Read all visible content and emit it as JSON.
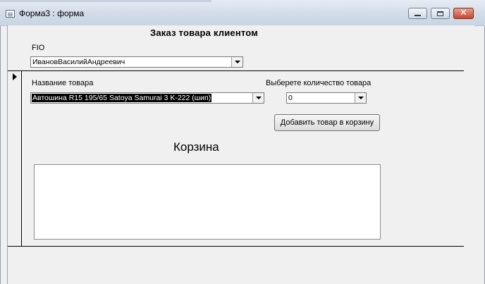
{
  "window": {
    "title": "Форма3 : форма",
    "minimize_icon": "minimize-icon",
    "maximize_icon": "maximize-icon",
    "close_icon": "close-icon",
    "close_glyph": "✕"
  },
  "form": {
    "title": "Заказ товара клиентом",
    "fio": {
      "label": "FIO",
      "value": "ИвановВасилийАндреевич"
    },
    "product": {
      "label": "Название товара",
      "value": "Автошина R15 195/65 Satoya Samurai 3 K-222 (шип)"
    },
    "quantity": {
      "label": "Выберете количество товара",
      "value": "0"
    },
    "add_button_label": "Добавить товар в корзину",
    "cart_title": "Корзина"
  }
}
